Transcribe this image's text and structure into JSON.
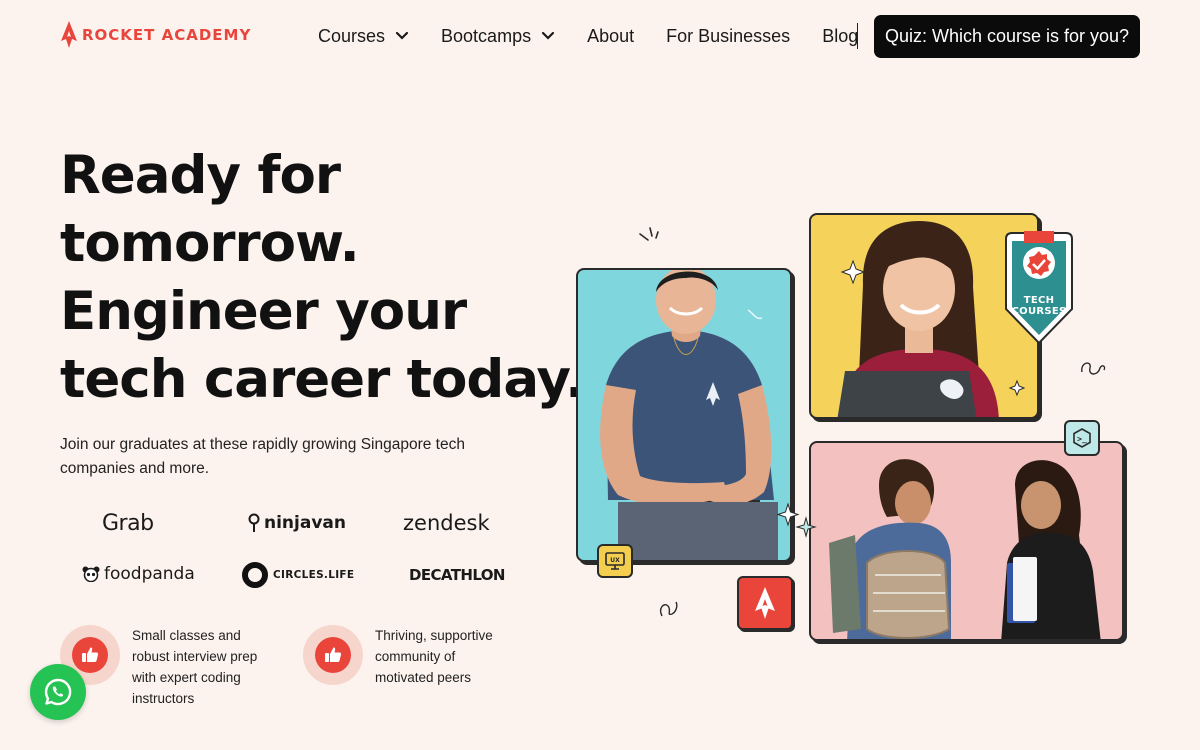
{
  "brand": {
    "name": "ROCKET ACADEMY",
    "color": "#e8453c"
  },
  "nav": {
    "items": [
      {
        "label": "Courses",
        "dropdown": true
      },
      {
        "label": "Bootcamps",
        "dropdown": true
      },
      {
        "label": "About",
        "dropdown": false
      },
      {
        "label": "For Businesses",
        "dropdown": false
      },
      {
        "label": "Blog",
        "dropdown": false
      }
    ],
    "cta_label": "Quiz: Which course is for you?"
  },
  "hero": {
    "headline_lines": [
      "Ready for",
      "tomorrow.",
      "Engineer your",
      "tech career today."
    ],
    "subtext": "Join our graduates at these rapidly growing Singapore tech companies and more."
  },
  "companies": {
    "grab": "Grab",
    "ninjavan": "ninjavan",
    "zendesk": "zendesk",
    "foodpanda": "foodpanda",
    "circles": "CIRCLES.LIFE",
    "decathlon": "DECATHLON"
  },
  "features": [
    {
      "text": "Small classes and robust interview prep with expert coding instructors",
      "icon": "thumbs-up-icon"
    },
    {
      "text": "Thriving, supportive community of motivated peers",
      "icon": "thumbs-up-icon"
    }
  ],
  "collage": {
    "badge_label": "TECH COURSES",
    "ux_tag": "UX",
    "code_tag": ">_"
  },
  "colors": {
    "background": "#fcf3ee",
    "accent": "#e9453b",
    "teal": "#7fd6dd",
    "yellow": "#f5d35a",
    "pink": "#f2c1c0",
    "whatsapp": "#25c254"
  }
}
